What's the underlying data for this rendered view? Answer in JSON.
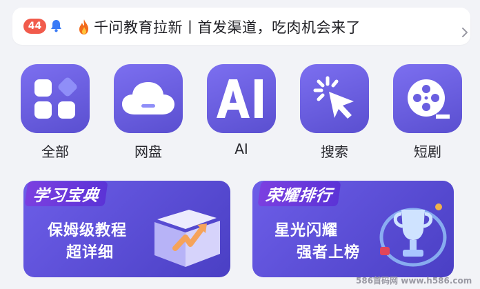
{
  "notice": {
    "badge_count": "44",
    "text": "千问教育拉新丨首发渠道，吃肉机会来了",
    "icons": [
      "bell-icon",
      "fire-icon",
      "chevron-right-icon"
    ]
  },
  "grid": {
    "items": [
      {
        "label": "全部",
        "icon": "apps-grid-icon"
      },
      {
        "label": "网盘",
        "icon": "cloud-drive-icon"
      },
      {
        "label": "AI",
        "icon": "ai-icon"
      },
      {
        "label": "搜索",
        "icon": "cursor-click-icon"
      },
      {
        "label": "短剧",
        "icon": "film-reel-icon"
      }
    ]
  },
  "banners": [
    {
      "tag": "学习宝典",
      "line1": "保姆级教程",
      "line2": "超详细",
      "icon": "book-icon"
    },
    {
      "tag": "荣耀排行",
      "line1": "星光闪耀",
      "line2": "强者上榜",
      "icon": "trophy-icon"
    }
  ],
  "watermark": "586首码网 www.h586.com",
  "colors": {
    "tile_gradient_start": "#7c6ff0",
    "tile_gradient_end": "#5a4fd0",
    "badge": "#f15b4c",
    "background": "#f2f3f7"
  }
}
